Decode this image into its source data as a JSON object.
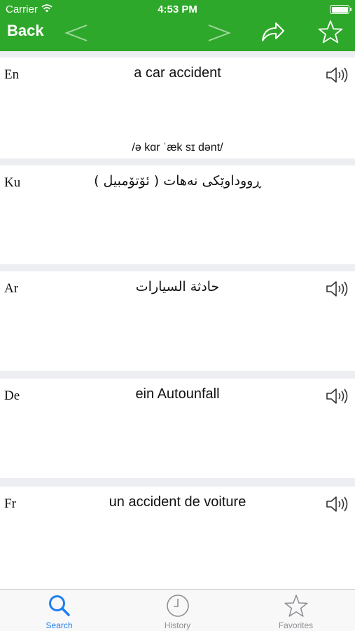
{
  "status_bar": {
    "carrier": "Carrier",
    "time": "4:53 PM",
    "battery_level": 1.0
  },
  "nav": {
    "back_label": "Back",
    "icons": [
      "chevron-left-icon",
      "chevron-right-icon",
      "share-arrow-icon",
      "star-icon"
    ]
  },
  "entries": [
    {
      "lang": "En",
      "text": "a car accident",
      "phonetic": "/ə kɑr ˈæk sɪ dənt/",
      "has_audio": true
    },
    {
      "lang": "Ku",
      "text": "ڕووداوێکی نەهات ( ئۆتۆمبیل )",
      "has_audio": false
    },
    {
      "lang": "Ar",
      "text": "حادثة السيارات",
      "has_audio": true
    },
    {
      "lang": "De",
      "text": "ein Autounfall",
      "has_audio": true
    },
    {
      "lang": "Fr",
      "text": "un accident de voiture",
      "has_audio": true
    }
  ],
  "tabs": [
    {
      "label": "Search",
      "icon": "search-icon",
      "active": true
    },
    {
      "label": "History",
      "icon": "clock-icon",
      "active": false
    },
    {
      "label": "Favorites",
      "icon": "star-icon",
      "active": false
    }
  ],
  "colors": {
    "header": "#2ea82a",
    "tab_active": "#1f7ef0",
    "tab_inactive": "#8e8e93",
    "separator": "#edeef2"
  }
}
